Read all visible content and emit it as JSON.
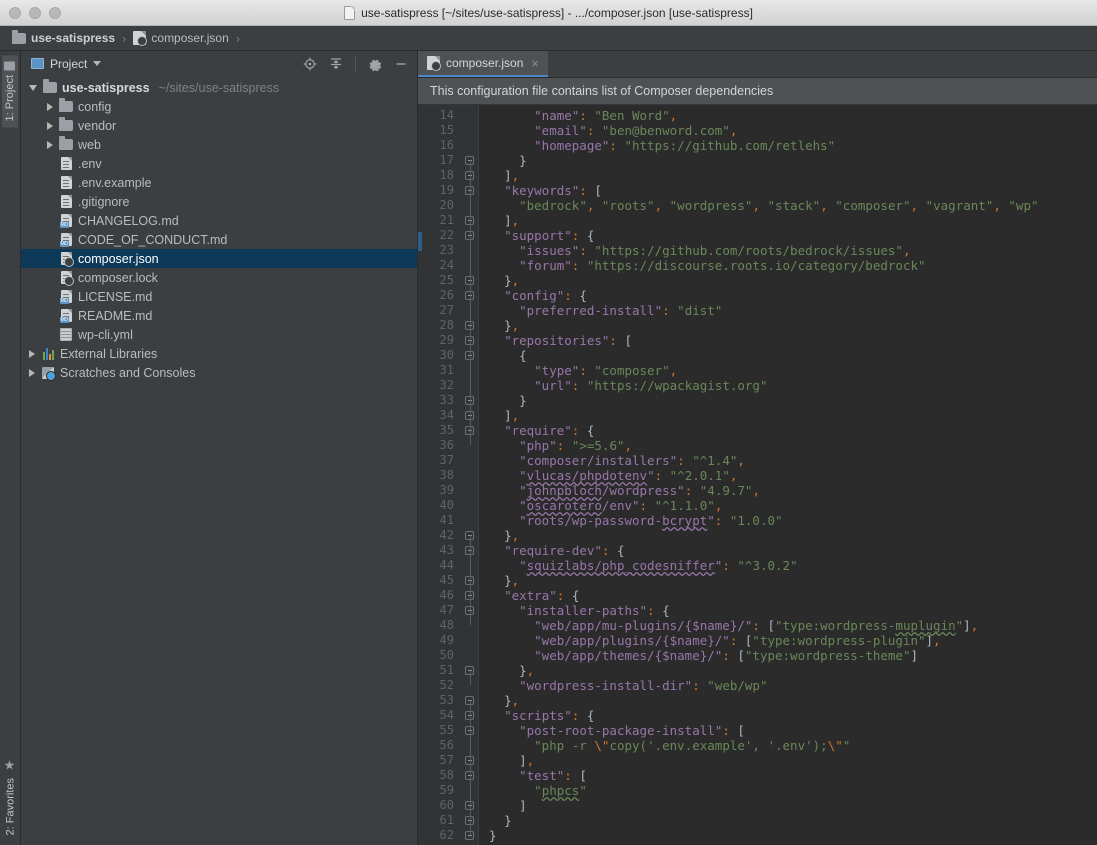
{
  "window": {
    "title": "use-satispress [~/sites/use-satispress] - .../composer.json [use-satispress]"
  },
  "breadcrumb": {
    "items": [
      {
        "label": "use-satispress",
        "icon": "folder-icon"
      },
      {
        "label": "composer.json",
        "icon": "json-file-icon"
      }
    ],
    "separator": "›"
  },
  "toolstrip": {
    "project_tab": "1: Project",
    "favorites_tab": "2: Favorites",
    "favorites_icon": "★"
  },
  "project_panel": {
    "title": "Project",
    "toolbar": [
      {
        "name": "scroll-from-source-icon",
        "label": "Scroll from Source"
      },
      {
        "name": "collapse-all-icon",
        "label": "Collapse All"
      },
      {
        "name": "gear-icon",
        "label": "Settings"
      },
      {
        "name": "hide-icon",
        "label": "Hide"
      }
    ],
    "tree": [
      {
        "label": "use-satispress",
        "sub": "~/sites/use-satispress",
        "indent": 0,
        "arrow": "open",
        "icon": "folder-icon",
        "bold": true,
        "selected": false
      },
      {
        "label": "config",
        "sub": "",
        "indent": 1,
        "arrow": "closed",
        "icon": "folder-icon",
        "bold": false,
        "selected": false
      },
      {
        "label": "vendor",
        "sub": "",
        "indent": 1,
        "arrow": "closed",
        "icon": "folder-icon",
        "bold": false,
        "selected": false
      },
      {
        "label": "web",
        "sub": "",
        "indent": 1,
        "arrow": "closed",
        "icon": "folder-icon",
        "bold": false,
        "selected": false
      },
      {
        "label": ".env",
        "sub": "",
        "indent": 1,
        "arrow": "none",
        "icon": "text-file-icon",
        "bold": false,
        "selected": false
      },
      {
        "label": ".env.example",
        "sub": "",
        "indent": 1,
        "arrow": "none",
        "icon": "text-file-icon",
        "bold": false,
        "selected": false
      },
      {
        "label": ".gitignore",
        "sub": "",
        "indent": 1,
        "arrow": "none",
        "icon": "text-file-icon",
        "bold": false,
        "selected": false
      },
      {
        "label": "CHANGELOG.md",
        "sub": "",
        "indent": 1,
        "arrow": "none",
        "icon": "markdown-file-icon",
        "bold": false,
        "selected": false
      },
      {
        "label": "CODE_OF_CONDUCT.md",
        "sub": "",
        "indent": 1,
        "arrow": "none",
        "icon": "markdown-file-icon",
        "bold": false,
        "selected": false
      },
      {
        "label": "composer.json",
        "sub": "",
        "indent": 1,
        "arrow": "none",
        "icon": "json-file-icon",
        "bold": false,
        "selected": true
      },
      {
        "label": "composer.lock",
        "sub": "",
        "indent": 1,
        "arrow": "none",
        "icon": "json-file-icon",
        "bold": false,
        "selected": false
      },
      {
        "label": "LICENSE.md",
        "sub": "",
        "indent": 1,
        "arrow": "none",
        "icon": "markdown-file-icon",
        "bold": false,
        "selected": false
      },
      {
        "label": "README.md",
        "sub": "",
        "indent": 1,
        "arrow": "none",
        "icon": "markdown-file-icon",
        "bold": false,
        "selected": false
      },
      {
        "label": "wp-cli.yml",
        "sub": "",
        "indent": 1,
        "arrow": "none",
        "icon": "yaml-file-icon",
        "bold": false,
        "selected": false
      },
      {
        "label": "External Libraries",
        "sub": "",
        "indent": 0,
        "arrow": "closed",
        "icon": "libraries-icon",
        "bold": false,
        "selected": false
      },
      {
        "label": "Scratches and Consoles",
        "sub": "",
        "indent": 0,
        "arrow": "closed",
        "icon": "scratches-icon",
        "bold": false,
        "selected": false
      }
    ]
  },
  "editor": {
    "tab": {
      "label": "composer.json",
      "icon": "json-file-icon",
      "close": "×"
    },
    "notification": "This configuration file contains list of Composer dependencies",
    "first_line_number": 14,
    "last_line_number": 62,
    "lines": [
      {
        "n": 14,
        "fold": false,
        "html": "      <span class=\"k\">\"name\"</span><span class=\"p\">:</span> <span class=\"s\">\"Ben Word\"</span><span class=\"p\">,</span>"
      },
      {
        "n": 15,
        "fold": false,
        "html": "      <span class=\"k\">\"email\"</span><span class=\"p\">:</span> <span class=\"s\">\"ben@benword.com\"</span><span class=\"p\">,</span>"
      },
      {
        "n": 16,
        "fold": false,
        "html": "      <span class=\"k\">\"homepage\"</span><span class=\"p\">:</span> <span class=\"s\">\"https://github.com/retlehs\"</span>"
      },
      {
        "n": 17,
        "fold": true,
        "html": "    <span class=\"b\">}</span>"
      },
      {
        "n": 18,
        "fold": true,
        "html": "  <span class=\"b\">]</span><span class=\"p\">,</span>"
      },
      {
        "n": 19,
        "fold": true,
        "html": "  <span class=\"k\">\"keywords\"</span><span class=\"p\">:</span> <span class=\"b\">[</span>"
      },
      {
        "n": 20,
        "fold": false,
        "html": "    <span class=\"s\">\"bedrock\"</span><span class=\"p\">,</span> <span class=\"s\">\"roots\"</span><span class=\"p\">,</span> <span class=\"s\">\"wordpress\"</span><span class=\"p\">,</span> <span class=\"s\">\"stack\"</span><span class=\"p\">,</span> <span class=\"s\">\"composer\"</span><span class=\"p\">,</span> <span class=\"s\">\"vagrant\"</span><span class=\"p\">,</span> <span class=\"s\">\"wp\"</span>"
      },
      {
        "n": 21,
        "fold": true,
        "html": "  <span class=\"b\">]</span><span class=\"p\">,</span>"
      },
      {
        "n": 22,
        "fold": true,
        "html": "  <span class=\"k\">\"support\"</span><span class=\"p\">:</span> <span class=\"b\">{</span>"
      },
      {
        "n": 23,
        "fold": false,
        "html": "    <span class=\"k\">\"issues\"</span><span class=\"p\">:</span> <span class=\"s\">\"https://github.com/roots/bedrock/issues\"</span><span class=\"p\">,</span>"
      },
      {
        "n": 24,
        "fold": false,
        "html": "    <span class=\"k\">\"forum\"</span><span class=\"p\">:</span> <span class=\"s\">\"https://discourse.roots.io/category/bedrock\"</span>"
      },
      {
        "n": 25,
        "fold": true,
        "html": "  <span class=\"b\">}</span><span class=\"p\">,</span>"
      },
      {
        "n": 26,
        "fold": true,
        "html": "  <span class=\"k\">\"config\"</span><span class=\"p\">:</span> <span class=\"b\">{</span>"
      },
      {
        "n": 27,
        "fold": false,
        "html": "    <span class=\"k\">\"preferred-install\"</span><span class=\"p\">:</span> <span class=\"s\">\"dist\"</span>"
      },
      {
        "n": 28,
        "fold": true,
        "html": "  <span class=\"b\">}</span><span class=\"p\">,</span>"
      },
      {
        "n": 29,
        "fold": true,
        "html": "  <span class=\"k\">\"repositories\"</span><span class=\"p\">:</span> <span class=\"b\">[</span>"
      },
      {
        "n": 30,
        "fold": true,
        "html": "    <span class=\"b\">{</span>"
      },
      {
        "n": 31,
        "fold": false,
        "html": "      <span class=\"k\">\"type\"</span><span class=\"p\">:</span> <span class=\"s\">\"composer\"</span><span class=\"p\">,</span>"
      },
      {
        "n": 32,
        "fold": false,
        "html": "      <span class=\"k\">\"url\"</span><span class=\"p\">:</span> <span class=\"s\">\"https://wpackagist.org\"</span>"
      },
      {
        "n": 33,
        "fold": true,
        "html": "    <span class=\"b\">}</span>"
      },
      {
        "n": 34,
        "fold": true,
        "html": "  <span class=\"b\">]</span><span class=\"p\">,</span>"
      },
      {
        "n": 35,
        "fold": true,
        "html": "  <span class=\"k\">\"require\"</span><span class=\"p\">:</span> <span class=\"b\">{</span>"
      },
      {
        "n": 36,
        "fold": false,
        "html": "    <span class=\"k\">\"php\"</span><span class=\"p\">:</span> <span class=\"s\">\"&gt;=5.6\"</span><span class=\"p\">,</span>"
      },
      {
        "n": 37,
        "fold": false,
        "html": "    <span class=\"k\">\"composer/installers\"</span><span class=\"p\">:</span> <span class=\"s\">\"^1.4\"</span><span class=\"p\">,</span>"
      },
      {
        "n": 38,
        "fold": false,
        "html": "    <span class=\"k\">\"<span class=\"spk\">vlucas/phpdotenv</span>\"</span><span class=\"p\">:</span> <span class=\"s\">\"^2.0.1\"</span><span class=\"p\">,</span>"
      },
      {
        "n": 39,
        "fold": false,
        "html": "    <span class=\"k\">\"<span class=\"spk\">johnpbloch</span>/wordpress\"</span><span class=\"p\">:</span> <span class=\"s\">\"4.9.7\"</span><span class=\"p\">,</span>"
      },
      {
        "n": 40,
        "fold": false,
        "html": "    <span class=\"k\">\"<span class=\"spk\">oscarotero</span>/env\"</span><span class=\"p\">:</span> <span class=\"s\">\"^1.1.0\"</span><span class=\"p\">,</span>"
      },
      {
        "n": 41,
        "fold": false,
        "html": "    <span class=\"k\">\"roots/wp-password-<span class=\"spk\">bcrypt</span>\"</span><span class=\"p\">:</span> <span class=\"s\">\"1.0.0\"</span>"
      },
      {
        "n": 42,
        "fold": true,
        "html": "  <span class=\"b\">}</span><span class=\"p\">,</span>"
      },
      {
        "n": 43,
        "fold": true,
        "html": "  <span class=\"k\">\"require-dev\"</span><span class=\"p\">:</span> <span class=\"b\">{</span>"
      },
      {
        "n": 44,
        "fold": false,
        "html": "    <span class=\"k\">\"<span class=\"spk\">squizlabs/php_codesniffer</span>\"</span><span class=\"p\">:</span> <span class=\"s\">\"^3.0.2\"</span>"
      },
      {
        "n": 45,
        "fold": true,
        "html": "  <span class=\"b\">}</span><span class=\"p\">,</span>"
      },
      {
        "n": 46,
        "fold": true,
        "html": "  <span class=\"k\">\"extra\"</span><span class=\"p\">:</span> <span class=\"b\">{</span>"
      },
      {
        "n": 47,
        "fold": true,
        "html": "    <span class=\"k\">\"installer-paths\"</span><span class=\"p\">:</span> <span class=\"b\">{</span>"
      },
      {
        "n": 48,
        "fold": false,
        "html": "      <span class=\"k\">\"web/app/mu-plugins/{$name}/\"</span><span class=\"p\">:</span> <span class=\"b\">[</span><span class=\"s\">\"type:wordpress-<span class=\"sp\">muplugin</span>\"</span><span class=\"b\">]</span><span class=\"p\">,</span>"
      },
      {
        "n": 49,
        "fold": false,
        "html": "      <span class=\"k\">\"web/app/plugins/{$name}/\"</span><span class=\"p\">:</span> <span class=\"b\">[</span><span class=\"s\">\"type:wordpress-plugin\"</span><span class=\"b\">]</span><span class=\"p\">,</span>"
      },
      {
        "n": 50,
        "fold": false,
        "html": "      <span class=\"k\">\"web/app/themes/{$name}/\"</span><span class=\"p\">:</span> <span class=\"b\">[</span><span class=\"s\">\"type:wordpress-theme\"</span><span class=\"b\">]</span>"
      },
      {
        "n": 51,
        "fold": true,
        "html": "    <span class=\"b\">}</span><span class=\"p\">,</span>"
      },
      {
        "n": 52,
        "fold": false,
        "html": "    <span class=\"k\">\"wordpress-install-dir\"</span><span class=\"p\">:</span> <span class=\"s\">\"web/wp\"</span>"
      },
      {
        "n": 53,
        "fold": true,
        "html": "  <span class=\"b\">}</span><span class=\"p\">,</span>"
      },
      {
        "n": 54,
        "fold": true,
        "html": "  <span class=\"k\">\"scripts\"</span><span class=\"p\">:</span> <span class=\"b\">{</span>"
      },
      {
        "n": 55,
        "fold": true,
        "html": "    <span class=\"k\">\"post-root-package-install\"</span><span class=\"p\">:</span> <span class=\"b\">[</span>"
      },
      {
        "n": 56,
        "fold": false,
        "html": "      <span class=\"s\">\"php -r <span class=\"e\">\\\"</span>copy('.env.example', '.env');<span class=\"e\">\\\"</span>\"</span>"
      },
      {
        "n": 57,
        "fold": true,
        "html": "    <span class=\"b\">]</span><span class=\"p\">,</span>"
      },
      {
        "n": 58,
        "fold": true,
        "html": "    <span class=\"k\">\"test\"</span><span class=\"p\">:</span> <span class=\"b\">[</span>"
      },
      {
        "n": 59,
        "fold": false,
        "html": "      <span class=\"s\">\"<span class=\"sp\">phpcs</span>\"</span>"
      },
      {
        "n": 60,
        "fold": true,
        "html": "    <span class=\"b\">]</span>"
      },
      {
        "n": 61,
        "fold": true,
        "html": "  <span class=\"b\">}</span>"
      },
      {
        "n": 62,
        "fold": true,
        "html": "<span class=\"b\">}</span>"
      }
    ]
  },
  "colors": {
    "editor_background": "#2b2b2b",
    "gutter_background": "#313335",
    "panel_background": "#3c3f41",
    "selection_blue": "#0d3a58",
    "tab_underline": "#4a88c7",
    "key_violet": "#9876aa",
    "string_green": "#6a8759",
    "punct_orange": "#cc7832",
    "default_text": "#a9b7c6"
  }
}
